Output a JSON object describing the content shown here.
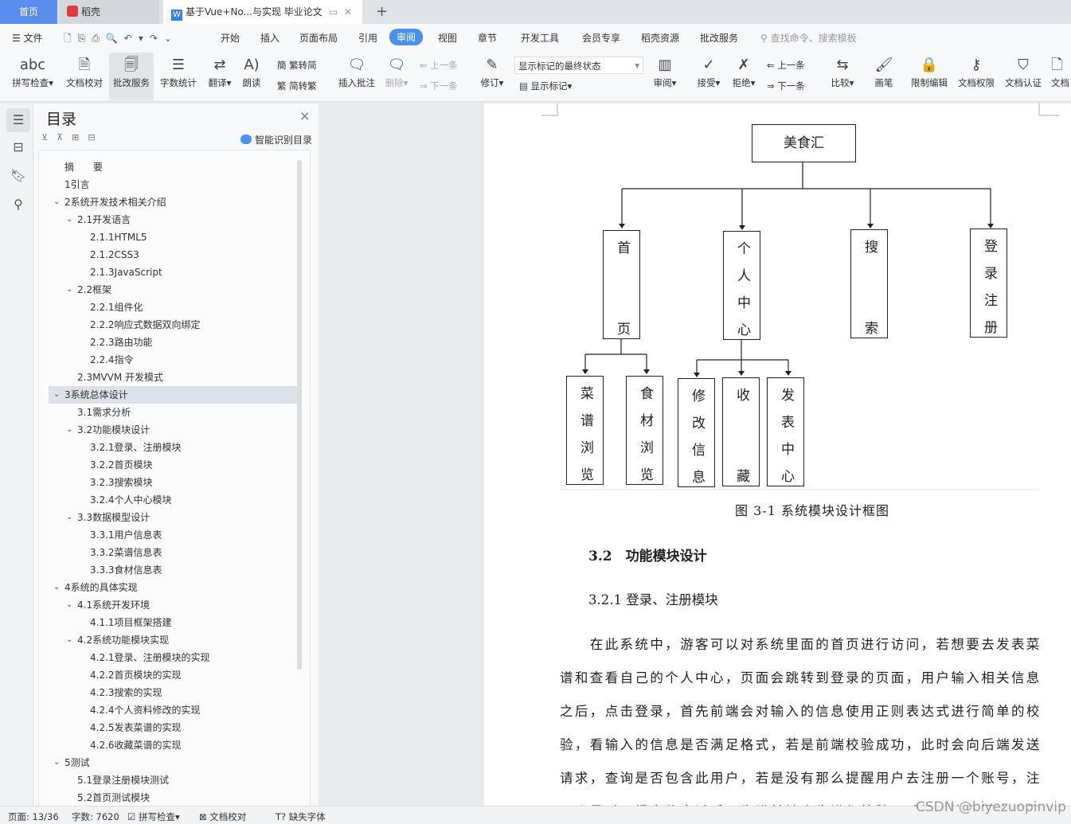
{
  "tabs": {
    "home": "首页",
    "docer": "稻壳",
    "doc": "基于Vue+No...与实现 毕业论文",
    "add": "+"
  },
  "menu": {
    "file": "文件",
    "items": [
      "开始",
      "插入",
      "页面布局",
      "引用",
      "审阅",
      "视图",
      "章节",
      "开发工具",
      "会员专享",
      "稻壳资源",
      "批改服务"
    ],
    "active": "审阅",
    "search_placeholder": "查找命令、搜索模板"
  },
  "ribbon": {
    "spell": "拼写检查",
    "proof": "文档校对",
    "correct": "批改服务",
    "wordcount": "字数统计",
    "translate": "翻译",
    "read": "朗读",
    "t2s": "繁转简",
    "s2t": "简转繁",
    "insert_comment": "插入批注",
    "delete": "删除",
    "prev": "上一条",
    "next": "下一条",
    "revise": "修订",
    "markup_select": "显示标记的最终状态",
    "show_markup": "显示标记",
    "review": "审阅",
    "accept": "接受",
    "reject": "拒绝",
    "prev2": "上一条",
    "next2": "下一条",
    "compare": "比较",
    "pen": "画笔",
    "restrict": "限制编辑",
    "rights": "文档权限",
    "certify": "文档认证",
    "more": "文档"
  },
  "panel": {
    "title": "目录",
    "smart": "智能识别目录",
    "close": "×"
  },
  "toc": [
    {
      "t": "摘　　要",
      "l": 0,
      "c": false
    },
    {
      "t": "1引言",
      "l": 0,
      "c": false
    },
    {
      "t": "2系统开发技术相关介绍",
      "l": 0,
      "c": true
    },
    {
      "t": "2.1开发语言",
      "l": 1,
      "c": true
    },
    {
      "t": "2.1.1HTML5",
      "l": 2,
      "c": false
    },
    {
      "t": "2.1.2CSS3",
      "l": 2,
      "c": false
    },
    {
      "t": "2.1.3JavaScript",
      "l": 2,
      "c": false
    },
    {
      "t": "2.2框架",
      "l": 1,
      "c": true
    },
    {
      "t": "2.2.1组件化",
      "l": 2,
      "c": false
    },
    {
      "t": "2.2.2响应式数据双向绑定",
      "l": 2,
      "c": false
    },
    {
      "t": "2.2.3路由功能",
      "l": 2,
      "c": false
    },
    {
      "t": "2.2.4指令",
      "l": 2,
      "c": false
    },
    {
      "t": "2.3MVVM 开发模式",
      "l": 1,
      "c": false
    },
    {
      "t": "3系统总体设计",
      "l": 0,
      "c": true,
      "sel": true
    },
    {
      "t": "3.1需求分析",
      "l": 1,
      "c": false
    },
    {
      "t": "3.2功能模块设计",
      "l": 1,
      "c": true
    },
    {
      "t": "3.2.1登录、注册模块",
      "l": 2,
      "c": false
    },
    {
      "t": "3.2.2首页模块",
      "l": 2,
      "c": false
    },
    {
      "t": "3.2.3搜索模块",
      "l": 2,
      "c": false
    },
    {
      "t": "3.2.4个人中心模块",
      "l": 2,
      "c": false
    },
    {
      "t": "3.3数据模型设计",
      "l": 1,
      "c": true
    },
    {
      "t": "3.3.1用户信息表",
      "l": 2,
      "c": false
    },
    {
      "t": "3.3.2菜谱信息表",
      "l": 2,
      "c": false
    },
    {
      "t": "3.3.3食材信息表",
      "l": 2,
      "c": false
    },
    {
      "t": "4系统的具体实现",
      "l": 0,
      "c": true
    },
    {
      "t": "4.1系统开发环境",
      "l": 1,
      "c": true
    },
    {
      "t": "4.1.1项目框架搭建",
      "l": 2,
      "c": false
    },
    {
      "t": "4.2系统功能模块实现",
      "l": 1,
      "c": true
    },
    {
      "t": "4.2.1登录、注册模块的实现",
      "l": 2,
      "c": false
    },
    {
      "t": "4.2.2首页模块的实现",
      "l": 2,
      "c": false
    },
    {
      "t": "4.2.3搜索的实现",
      "l": 2,
      "c": false
    },
    {
      "t": "4.2.4个人资料修改的实现",
      "l": 2,
      "c": false
    },
    {
      "t": "4.2.5发表菜谱的实现",
      "l": 2,
      "c": false
    },
    {
      "t": "4.2.6收藏菜谱的实现",
      "l": 2,
      "c": false
    },
    {
      "t": "5测试",
      "l": 0,
      "c": true
    },
    {
      "t": "5.1登录注册模块测试",
      "l": 1,
      "c": false
    },
    {
      "t": "5.2首页测试模块",
      "l": 1,
      "c": false
    }
  ],
  "diagram": {
    "root": "美食汇",
    "level1": [
      "首页",
      "个人中心",
      "搜索",
      "登录注册"
    ],
    "level2_home": [
      "菜谱浏览",
      "食材浏览"
    ],
    "level2_personal": [
      "修改信息",
      "收藏",
      "发表中心"
    ],
    "caption": "图 3-1 系统模块设计框图"
  },
  "doc": {
    "h2": "3.2　功能模块设计",
    "h3": "3.2.1  登录、注册模块",
    "para": [
      "　　在此系统中，游客可以对系统里面的首页进行访问，若想要去发表菜",
      "谱和查看自己的个人中心，页面会跳转到登录的页面，用户输入相关信息",
      "之后，点击登录，首先前端会对输入的信息使用正则表达式进行简单的校",
      "验，看输入的信息是否满足格式，若是前端校验成功，此时会向后端发送",
      "请求，查询是否包含此用户，若是没有那么提醒用户去注册一个账号，注",
      "册账号时，提交信息过后，先进前端会先进行校验，后端查询数据库中是"
    ]
  },
  "status": {
    "page": "页面: 13/36",
    "words": "字数: 7620",
    "spell": "拼写检查",
    "proof": "文档校对",
    "font": "缺失字体",
    "watermark": "CSDN @biyezuopinvip"
  },
  "colors": {
    "accent": "#4a90f0",
    "home_tab": "#5b8def"
  }
}
